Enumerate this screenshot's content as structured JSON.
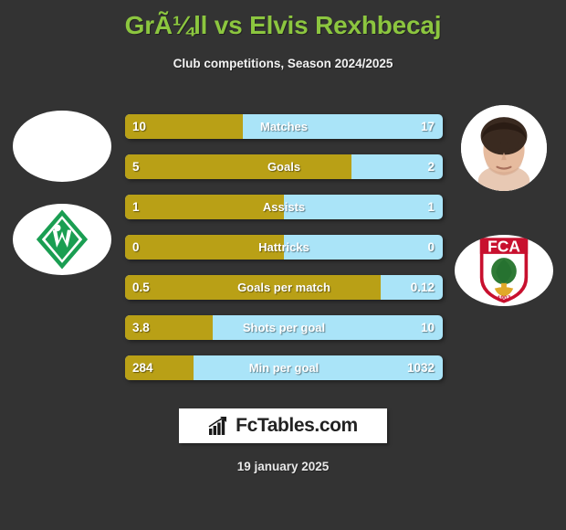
{
  "header": {
    "title": "GrÃ¼ll vs Elvis Rexhbecaj",
    "subtitle": "Club competitions, Season 2024/2025"
  },
  "colors": {
    "background": "#333333",
    "title_green": "#8cc63f",
    "home_bar": "#b9a016",
    "away_bar": "#aae4f8",
    "text_white": "#ffffff"
  },
  "left_player": {
    "photo": "player-photo-placeholder",
    "club_logo": "werder-bremen-logo"
  },
  "right_player": {
    "photo": "player-photo-rexhbecaj",
    "club_logo": "fc-augsburg-logo"
  },
  "stats": [
    {
      "label": "Matches",
      "home": "10",
      "away": "17",
      "home_pct": 37.0
    },
    {
      "label": "Goals",
      "home": "5",
      "away": "2",
      "home_pct": 71.4
    },
    {
      "label": "Assists",
      "home": "1",
      "away": "1",
      "home_pct": 50.0
    },
    {
      "label": "Hattricks",
      "home": "0",
      "away": "0",
      "home_pct": 50.0
    },
    {
      "label": "Goals per match",
      "home": "0.5",
      "away": "0.12",
      "home_pct": 80.6
    },
    {
      "label": "Shots per goal",
      "home": "3.8",
      "away": "10",
      "home_pct": 27.5
    },
    {
      "label": "Min per goal",
      "home": "284",
      "away": "1032",
      "home_pct": 21.6
    }
  ],
  "footer": {
    "brand_name": "FcTables.com",
    "brand_icon": "bar-chart-icon",
    "date": "19 january 2025"
  }
}
